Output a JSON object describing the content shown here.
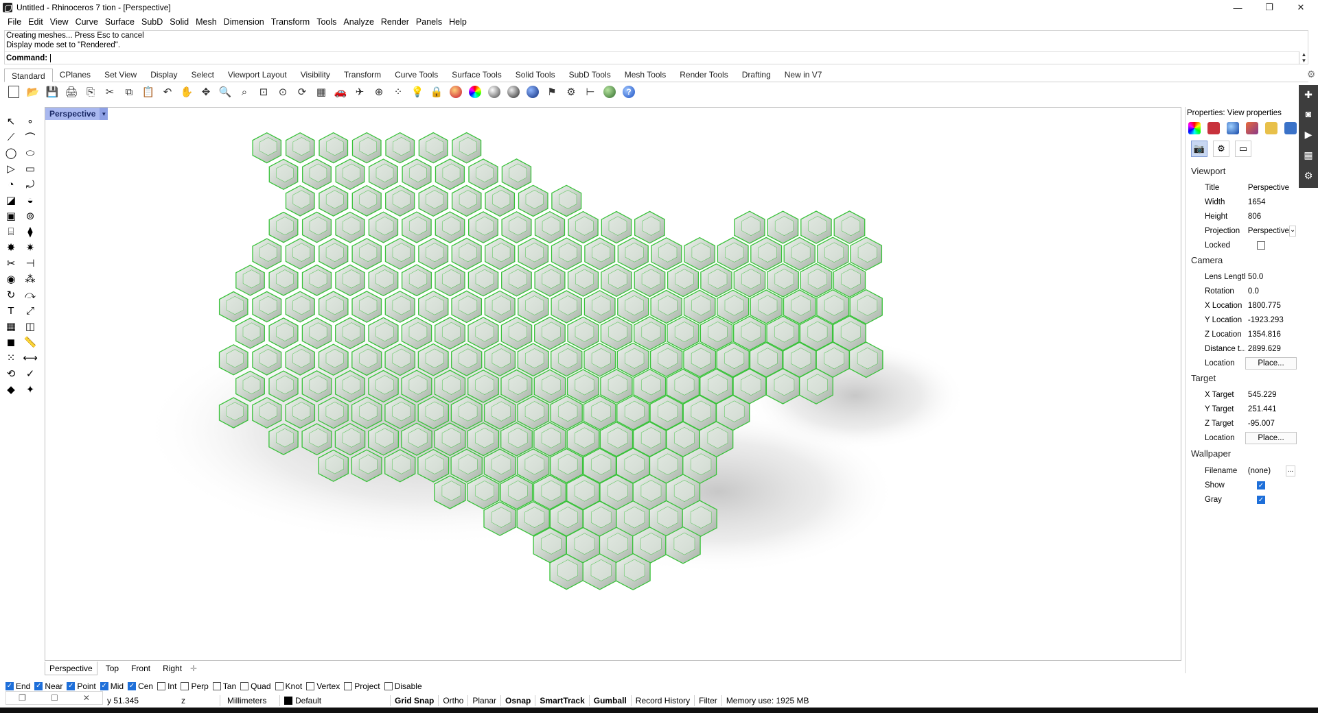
{
  "window": {
    "title": "Untitled - Rhinoceros 7 tion - [Perspective]",
    "minimize_glyph": "—",
    "maximize_glyph": "❐",
    "close_glyph": "✕"
  },
  "menu": [
    "File",
    "Edit",
    "View",
    "Curve",
    "Surface",
    "SubD",
    "Solid",
    "Mesh",
    "Dimension",
    "Transform",
    "Tools",
    "Analyze",
    "Render",
    "Panels",
    "Help"
  ],
  "command": {
    "history": [
      "Creating meshes... Press Esc to cancel",
      "Display mode set to \"Rendered\"."
    ],
    "prompt_label": "Command:",
    "value": ""
  },
  "toolbar_tabs": [
    "Standard",
    "CPlanes",
    "Set View",
    "Display",
    "Select",
    "Viewport Layout",
    "Visibility",
    "Transform",
    "Curve Tools",
    "Surface Tools",
    "Solid Tools",
    "SubD Tools",
    "Mesh Tools",
    "Render Tools",
    "Drafting",
    "New in V7"
  ],
  "toolbar_active_tab": "Standard",
  "toolbar_icons": [
    "new-icon",
    "open-icon",
    "save-icon",
    "print-icon",
    "import-icon",
    "cut-icon",
    "copy-icon",
    "paste-icon",
    "undo-icon",
    "pan-icon",
    "move-icon",
    "zoom-icon",
    "zoom-window-icon",
    "zoom-extents-icon",
    "zoom-selected-icon",
    "rotate-view-icon",
    "four-viewports-icon",
    "car-icon",
    "plane-icon",
    "cplane-icon",
    "point-icon",
    "light-icon",
    "lock-icon",
    "material-icon",
    "color-wheel-icon",
    "shaded-sphere-icon",
    "rendered-sphere-icon",
    "render-sphere-icon",
    "flag-icon",
    "settings-gear-icon",
    "dimension-icon",
    "grasshopper-icon",
    "help-icon"
  ],
  "viewport": {
    "active_label": "Perspective",
    "tabs": [
      "Perspective",
      "Top",
      "Front",
      "Right"
    ],
    "add_glyph": "✛"
  },
  "osnap": [
    {
      "label": "End",
      "checked": true
    },
    {
      "label": "Near",
      "checked": true
    },
    {
      "label": "Point",
      "checked": true
    },
    {
      "label": "Mid",
      "checked": true
    },
    {
      "label": "Cen",
      "checked": true
    },
    {
      "label": "Int",
      "checked": false
    },
    {
      "label": "Perp",
      "checked": false
    },
    {
      "label": "Tan",
      "checked": false
    },
    {
      "label": "Quad",
      "checked": false
    },
    {
      "label": "Knot",
      "checked": false
    },
    {
      "label": "Vertex",
      "checked": false
    },
    {
      "label": "Project",
      "checked": false
    },
    {
      "label": "Disable",
      "checked": false
    }
  ],
  "status": {
    "y": "y 51.345",
    "z": "z",
    "units": "Millimeters",
    "layer": "Default",
    "toggles": [
      {
        "label": "Grid Snap",
        "bold": true
      },
      {
        "label": "Ortho",
        "bold": false
      },
      {
        "label": "Planar",
        "bold": false
      },
      {
        "label": "Osnap",
        "bold": true
      },
      {
        "label": "SmartTrack",
        "bold": true
      },
      {
        "label": "Gumball",
        "bold": true
      },
      {
        "label": "Record History",
        "bold": false
      },
      {
        "label": "Filter",
        "bold": false
      }
    ],
    "memory": "Memory use: 1925 MB"
  },
  "properties": {
    "title": "Properties: View properties",
    "sections": {
      "viewport": "Viewport",
      "camera": "Camera",
      "target": "Target",
      "wallpaper": "Wallpaper"
    },
    "viewport": {
      "title_label": "Title",
      "title": "Perspective",
      "width_label": "Width",
      "width": "1654",
      "height_label": "Height",
      "height": "806",
      "projection_label": "Projection",
      "projection": "Perspective",
      "locked_label": "Locked"
    },
    "camera": {
      "lens_label": "Lens Length",
      "lens": "50.0",
      "rotation_label": "Rotation",
      "rotation": "0.0",
      "x_label": "X Location",
      "x": "1800.775",
      "y_label": "Y Location",
      "y": "-1923.293",
      "z_label": "Z Location",
      "z": "1354.816",
      "dist_label": "Distance t...",
      "dist": "2899.629",
      "loc_label": "Location",
      "loc_button": "Place..."
    },
    "target": {
      "x_label": "X Target",
      "x": "545.229",
      "y_label": "Y Target",
      "y": "251.441",
      "z_label": "Z Target",
      "z": "-95.007",
      "loc_label": "Location",
      "loc_button": "Place..."
    },
    "wallpaper": {
      "filename_label": "Filename",
      "filename": "(none)",
      "dots": "...",
      "show_label": "Show",
      "gray_label": "Gray"
    }
  },
  "colors": {
    "hex_fill": "#bdbdbd",
    "hex_edge": "#39c23a",
    "viewport_label_bg": "#a9b8ef",
    "check_blue": "#1e6fd9"
  }
}
